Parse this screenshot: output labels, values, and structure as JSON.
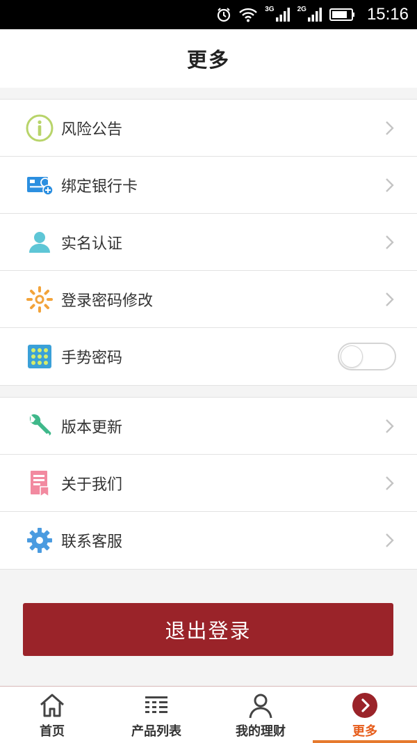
{
  "status_bar": {
    "network_1": "3G",
    "network_2": "2G",
    "time": "15:16"
  },
  "header": {
    "title": "更多"
  },
  "menu_group_1": [
    {
      "label": "风险公告",
      "icon": "info-circle-icon",
      "trailing": "chevron"
    },
    {
      "label": "绑定银行卡",
      "icon": "bank-card-icon",
      "trailing": "chevron"
    },
    {
      "label": "实名认证",
      "icon": "user-icon",
      "trailing": "chevron"
    },
    {
      "label": "登录密码修改",
      "icon": "sun-icon",
      "trailing": "chevron"
    },
    {
      "label": "手势密码",
      "icon": "gesture-grid-icon",
      "trailing": "toggle",
      "toggle_on": false
    }
  ],
  "menu_group_2": [
    {
      "label": "版本更新",
      "icon": "wrench-icon",
      "trailing": "chevron"
    },
    {
      "label": "关于我们",
      "icon": "document-bookmark-icon",
      "trailing": "chevron"
    },
    {
      "label": "联系客服",
      "icon": "gear-icon",
      "trailing": "chevron"
    }
  ],
  "logout_button": {
    "label": "退出登录"
  },
  "tabbar": {
    "tabs": [
      {
        "label": "首页",
        "icon": "home-icon",
        "active": false
      },
      {
        "label": "产品列表",
        "icon": "list-icon",
        "active": false
      },
      {
        "label": "我的理财",
        "icon": "person-outline-icon",
        "active": false
      },
      {
        "label": "更多",
        "icon": "more-chevron-circle-icon",
        "active": true
      }
    ]
  },
  "colors": {
    "brand_red": "#9a2329",
    "active_tab": "#e65c1a",
    "info_icon": "#b8d46a",
    "card_icon": "#2c8fe0",
    "user_icon": "#5ec6d6",
    "sun_icon": "#f2a33a",
    "grid_icon": "#3aa0d8",
    "wrench_icon": "#3fb88a",
    "doc_icon": "#f28aa0",
    "gear_icon": "#4a9be0"
  }
}
